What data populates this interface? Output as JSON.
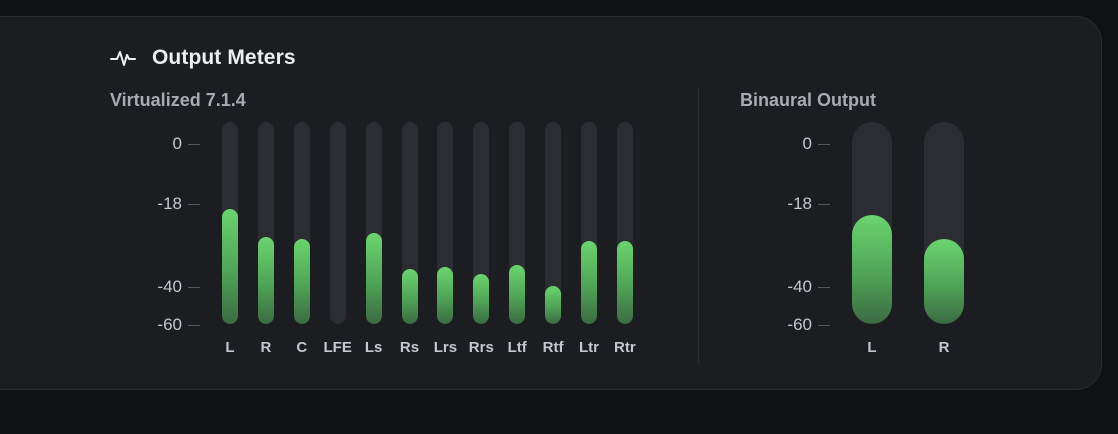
{
  "header": {
    "title": "Output Meters",
    "icon": "waveform-icon"
  },
  "colors": {
    "background": "#101114",
    "panel": "#1c1d21",
    "meter_track": "#2c2d32",
    "meter_fill_top": "#6bd46f",
    "meter_fill_bottom": "#3b6a42"
  },
  "virtualized": {
    "title": "Virtualized 7.1.4",
    "scale_ticks": [
      "0",
      "-18",
      "-40",
      "-60"
    ],
    "channels": [
      {
        "label": "L",
        "level": 0.57
      },
      {
        "label": "R",
        "level": 0.43
      },
      {
        "label": "C",
        "level": 0.42
      },
      {
        "label": "LFE",
        "level": 0.0
      },
      {
        "label": "Ls",
        "level": 0.45
      },
      {
        "label": "Rs",
        "level": 0.27
      },
      {
        "label": "Lrs",
        "level": 0.28
      },
      {
        "label": "Rrs",
        "level": 0.25
      },
      {
        "label": "Ltf",
        "level": 0.29
      },
      {
        "label": "Rtf",
        "level": 0.19
      },
      {
        "label": "Ltr",
        "level": 0.41
      },
      {
        "label": "Rtr",
        "level": 0.41
      }
    ]
  },
  "binaural": {
    "title": "Binaural Output",
    "scale_ticks": [
      "0",
      "-18",
      "-40",
      "-60"
    ],
    "channels": [
      {
        "label": "L",
        "level": 0.54
      },
      {
        "label": "R",
        "level": 0.42
      }
    ]
  }
}
